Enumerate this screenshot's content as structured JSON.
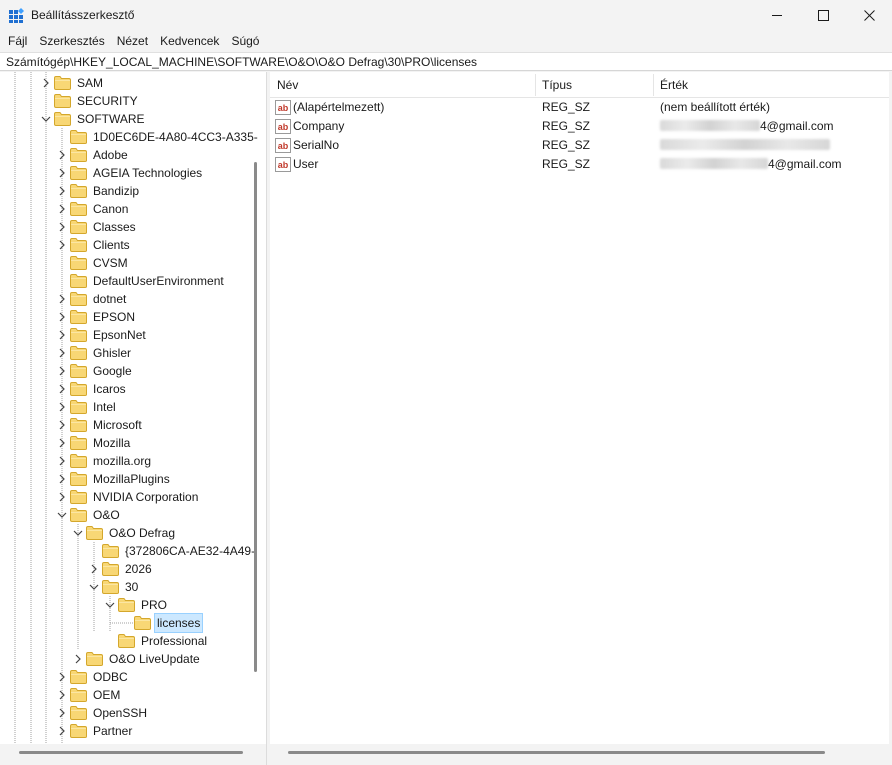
{
  "window": {
    "title": "Beállításszerkesztő"
  },
  "menu": [
    "Fájl",
    "Szerkesztés",
    "Nézet",
    "Kedvencek",
    "Súgó"
  ],
  "address": "Számítógép\\HKEY_LOCAL_MACHINE\\SOFTWARE\\O&O\\O&O Defrag\\30\\PRO\\licenses",
  "tree": [
    {
      "label": "SAM"
    },
    {
      "label": "SECURITY"
    },
    {
      "label": "SOFTWARE"
    },
    {
      "label": "1D0EC6DE-4A80-4CC3-A335-"
    },
    {
      "label": "Adobe"
    },
    {
      "label": "AGEIA Technologies"
    },
    {
      "label": "Bandizip"
    },
    {
      "label": "Canon"
    },
    {
      "label": "Classes"
    },
    {
      "label": "Clients"
    },
    {
      "label": "CVSM"
    },
    {
      "label": "DefaultUserEnvironment"
    },
    {
      "label": "dotnet"
    },
    {
      "label": "EPSON"
    },
    {
      "label": "EpsonNet"
    },
    {
      "label": "Ghisler"
    },
    {
      "label": "Google"
    },
    {
      "label": "Icaros"
    },
    {
      "label": "Intel"
    },
    {
      "label": "Microsoft"
    },
    {
      "label": "Mozilla"
    },
    {
      "label": "mozilla.org"
    },
    {
      "label": "MozillaPlugins"
    },
    {
      "label": "NVIDIA Corporation"
    },
    {
      "label": "O&O"
    },
    {
      "label": "O&O Defrag"
    },
    {
      "label": "{372806CA-AE32-4A49-"
    },
    {
      "label": "2026"
    },
    {
      "label": "30"
    },
    {
      "label": "PRO"
    },
    {
      "label": "licenses"
    },
    {
      "label": "Professional"
    },
    {
      "label": "O&O LiveUpdate"
    },
    {
      "label": "ODBC"
    },
    {
      "label": "OEM"
    },
    {
      "label": "OpenSSH"
    },
    {
      "label": "Partner"
    }
  ],
  "list": {
    "columns": [
      "Név",
      "Típus",
      "Érték"
    ],
    "rows": [
      {
        "name": "(Alapértelmezett)",
        "type": "REG_SZ",
        "data": "(nem beállított érték)",
        "suffix": ""
      },
      {
        "name": "Company",
        "type": "REG_SZ",
        "data": "",
        "suffix": "4@gmail.com"
      },
      {
        "name": "SerialNo",
        "type": "REG_SZ",
        "data": "",
        "suffix": ""
      },
      {
        "name": "User",
        "type": "REG_SZ",
        "data": "",
        "suffix": "4@gmail.com"
      }
    ]
  },
  "icons": {
    "app": "registry-editor-icon",
    "folder": "folder-icon",
    "value": "string-value-icon",
    "expand": "chevron-right-icon",
    "collapse": "chevron-down-icon"
  },
  "colors": {
    "selection": "#cce8ff",
    "folder": "#f8d775",
    "value_icon": "#c0392b",
    "background": "#f3f3f3"
  }
}
